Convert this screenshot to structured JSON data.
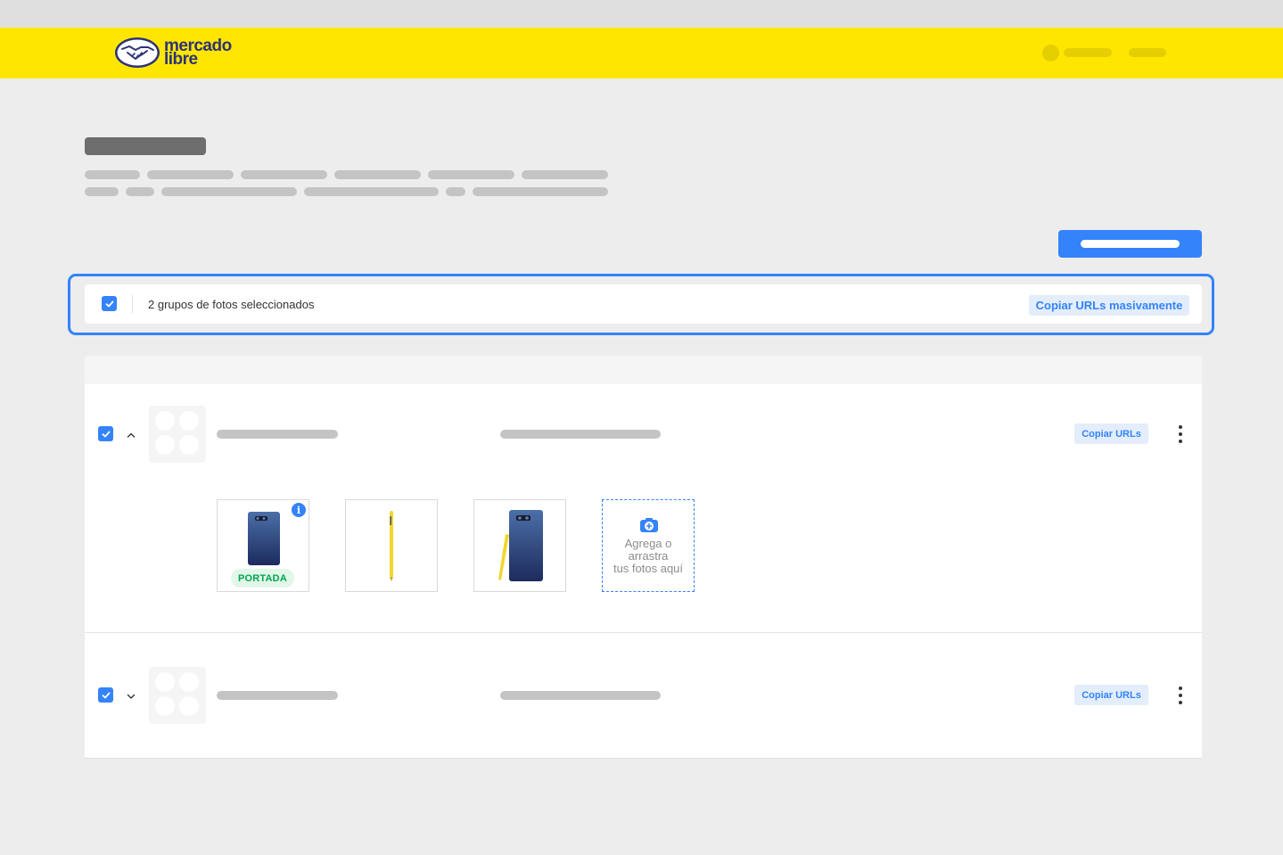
{
  "brand": {
    "line1": "mercado",
    "line2": "libre"
  },
  "selection_bar": {
    "text": "2 grupos de fotos seleccionados",
    "copy_all_label": "Copiar URLs masivamente"
  },
  "groups": [
    {
      "expanded": true,
      "copy_label": "Copiar URLs"
    },
    {
      "expanded": false,
      "copy_label": "Copiar URLs"
    }
  ],
  "photos": {
    "cover_badge": "PORTADA",
    "info_icon": "i",
    "add_text": "Agrega o\narrastra\ntus fotos aquí"
  },
  "icons": [
    "handshake-logo-icon",
    "checkbox-checked-icon",
    "chevron-up-icon",
    "chevron-down-icon",
    "kebab-menu-icon",
    "info-icon",
    "camera-add-icon"
  ],
  "colors": {
    "brand_yellow": "#ffe600",
    "primary_blue": "#3483fa",
    "success_green": "#00a650"
  }
}
